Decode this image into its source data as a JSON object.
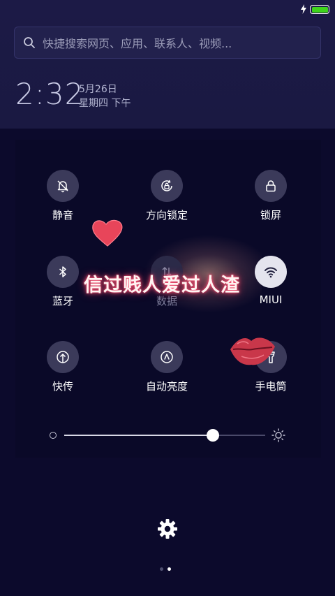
{
  "status_bar": {
    "battery_color": "#3fd41c",
    "charging": true
  },
  "search": {
    "placeholder": "快捷搜索网页、应用、联系人、视频..."
  },
  "clock": {
    "time": "2:32",
    "date": "5月26日",
    "weekday_period": "星期四 下午"
  },
  "quick_settings": {
    "tiles": [
      {
        "label": "静音",
        "icon": "bell-off-icon",
        "active": false
      },
      {
        "label": "方向锁定",
        "icon": "rotation-lock-icon",
        "active": false
      },
      {
        "label": "锁屏",
        "icon": "lock-icon",
        "active": false
      },
      {
        "label": "蓝牙",
        "icon": "bluetooth-icon",
        "active": false
      },
      {
        "label": "数据",
        "icon": "mobile-data-icon",
        "active": false
      },
      {
        "label": "MIUI",
        "icon": "wifi-icon",
        "active": true
      },
      {
        "label": "快传",
        "icon": "quick-transfer-icon",
        "active": false
      },
      {
        "label": "自动亮度",
        "icon": "auto-brightness-icon",
        "active": false
      },
      {
        "label": "手电筒",
        "icon": "flashlight-icon",
        "active": false
      }
    ],
    "brightness": {
      "level": 0.74
    }
  },
  "overlay": {
    "text": "信过贱人爱过人渣"
  },
  "pager": {
    "page_count": 2,
    "current_page": 2
  },
  "colors": {
    "background": "#0c0a2c",
    "panel": "#1c1a46",
    "tile_bg": "#3b3a5a",
    "tile_active_bg": "#e4e4ee"
  }
}
